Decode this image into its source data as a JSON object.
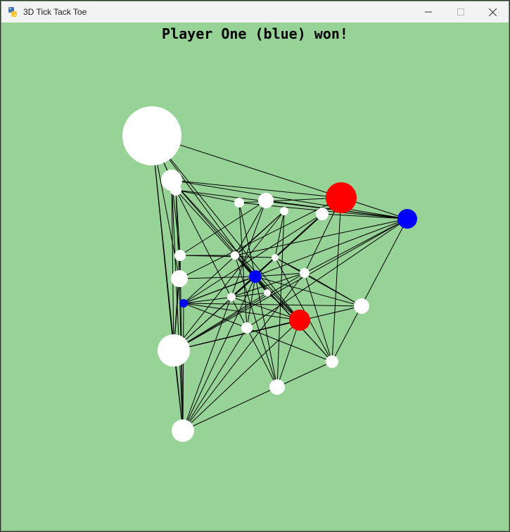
{
  "window": {
    "title": "3D Tick Tack Toe",
    "app_icon": "python-icon",
    "controls": [
      "minimize-icon",
      "maximize-icon",
      "close-icon"
    ]
  },
  "game": {
    "status_text": "Player One (blue) won!",
    "background_color": "#97d296",
    "colors": {
      "empty": "#ffffff",
      "player_one": "#0000ff",
      "player_two": "#ff0000",
      "line": "#000000"
    },
    "nodes": [
      {
        "state": "empty"
      },
      {
        "state": "empty"
      },
      {
        "state": "empty"
      },
      {
        "state": "empty"
      },
      {
        "state": "empty"
      },
      {
        "state": "empty"
      },
      {
        "state": "empty"
      },
      {
        "state": "player_two"
      },
      {
        "state": "player_one"
      },
      {
        "state": "empty"
      },
      {
        "state": "empty"
      },
      {
        "state": "empty"
      },
      {
        "state": "empty"
      },
      {
        "state": "player_one"
      },
      {
        "state": "empty"
      },
      {
        "state": "player_one"
      },
      {
        "state": "empty"
      },
      {
        "state": "empty"
      },
      {
        "state": "empty"
      },
      {
        "state": "empty"
      },
      {
        "state": "player_two"
      },
      {
        "state": "empty"
      },
      {
        "state": "empty"
      },
      {
        "state": "empty"
      },
      {
        "state": "empty"
      }
    ]
  }
}
